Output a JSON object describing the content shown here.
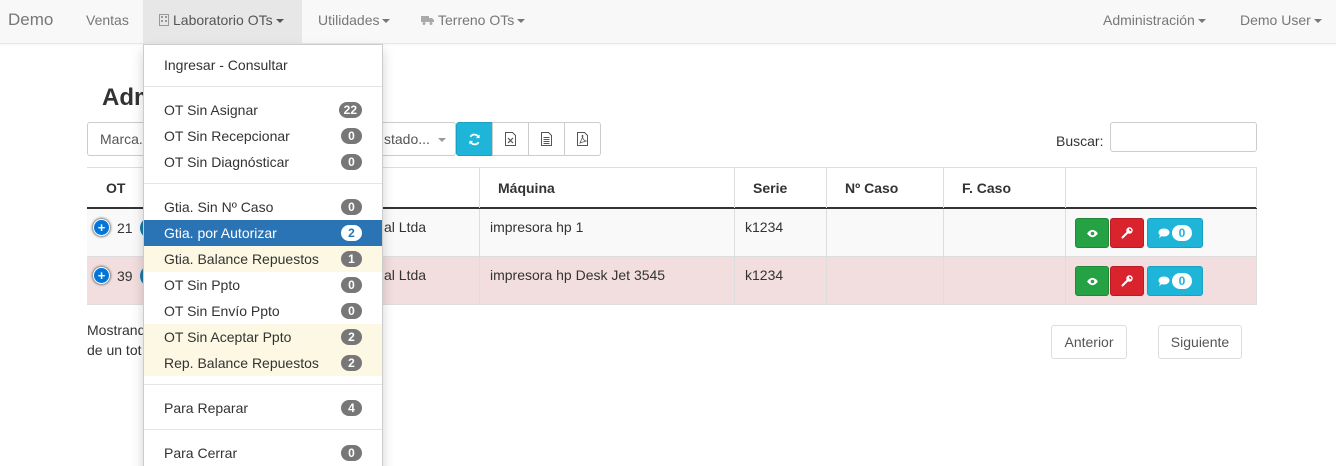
{
  "navbar": {
    "brand": "Demo",
    "items": [
      "Ventas",
      "Laboratorio OTs",
      "Utilidades",
      "Terreno OTs"
    ],
    "right_items": [
      "Administración",
      "Demo User"
    ]
  },
  "dropdown": {
    "items": [
      {
        "label": "Ingresar - Consultar"
      },
      {
        "label": "OT Sin Asignar",
        "badge": "22"
      },
      {
        "label": "OT Sin Recepcionar",
        "badge": "0"
      },
      {
        "label": "OT Sin Diagnósticar",
        "badge": "0"
      },
      {
        "label": "Gtia. Sin Nº Caso",
        "badge": "0"
      },
      {
        "label": "Gtia. por Autorizar",
        "badge": "2",
        "state": "active"
      },
      {
        "label": "Gtia. Balance Repuestos",
        "badge": "1",
        "state": "warning"
      },
      {
        "label": "OT Sin Ppto",
        "badge": "0"
      },
      {
        "label": "OT Sin Envío Ppto",
        "badge": "0"
      },
      {
        "label": "OT Sin Aceptar Ppto",
        "badge": "2",
        "state": "warning"
      },
      {
        "label": "Rep. Balance Repuestos",
        "badge": "2",
        "state": "warning"
      },
      {
        "label": "Para Reparar",
        "badge": "4"
      },
      {
        "label": "Para Cerrar",
        "badge": "0"
      }
    ]
  },
  "page": {
    "title_visible": "Adm",
    "filters": {
      "marca": "Marca.",
      "estado": "stado..."
    },
    "search_label": "Buscar:",
    "search_value": ""
  },
  "table": {
    "headers": [
      "OT",
      "Máquina",
      "Serie",
      "Nº Caso",
      "F. Caso"
    ],
    "rows": [
      {
        "ot": "21",
        "cliente": "al Ltda",
        "maquina": "impresora hp 1",
        "serie": "k1234",
        "caso": "",
        "fcaso": "",
        "comments": "0",
        "state": "odd"
      },
      {
        "ot": "39",
        "cliente": "al Ltda",
        "maquina": "impresora hp Desk Jet 3545",
        "serie": "k1234",
        "caso": "",
        "fcaso": "",
        "comments": "0",
        "state": "danger"
      }
    ]
  },
  "footer": {
    "info_line1": "Mostrand",
    "info_line2": "de un tot",
    "prev": "Anterior",
    "next": "Siguiente"
  },
  "colors": {
    "active_item": "#2a74b6",
    "warning_item": "#fcf8e3",
    "danger_row": "#f2dede",
    "info_button": "#1fb5d8",
    "success_button": "#25a244",
    "danger_button": "#d9232d"
  }
}
